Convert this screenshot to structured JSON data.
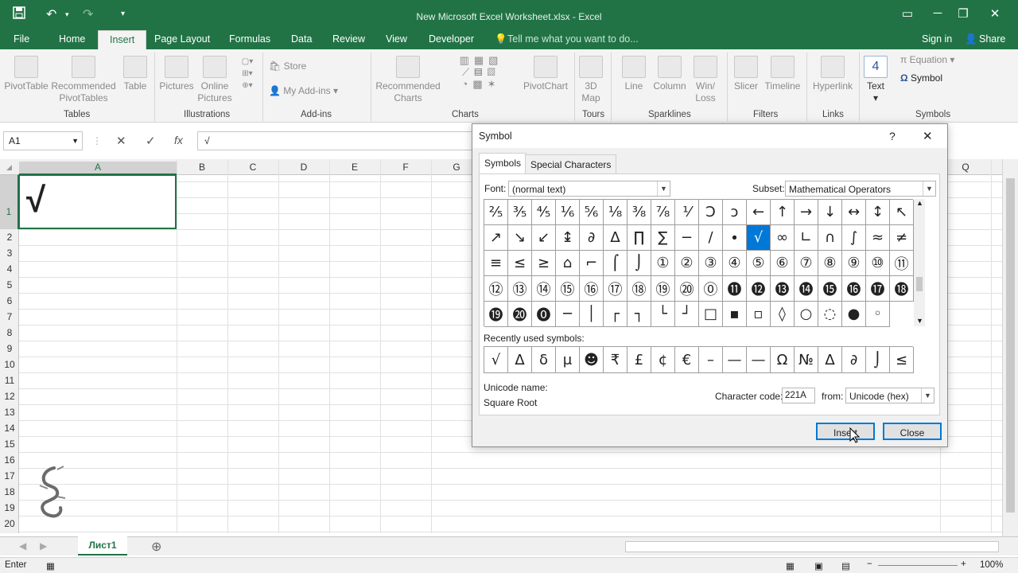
{
  "titlebar": {
    "title": "New Microsoft Excel Worksheet.xlsx - Excel"
  },
  "icons": {
    "save": "save-icon",
    "undo": "undo-icon",
    "redo": "redo-icon",
    "customize": "customize-qat-icon"
  },
  "tabs": [
    "File",
    "Home",
    "Insert",
    "Page Layout",
    "Formulas",
    "Data",
    "Review",
    "View",
    "Developer"
  ],
  "active_tab": "Insert",
  "tellme": "Tell me what you want to do...",
  "signin": "Sign in",
  "share": "Share",
  "ribbon": {
    "pivottable": "PivotTable",
    "recommended_pivot": "Recommended PivotTables",
    "table": "Table",
    "pictures": "Pictures",
    "online_pictures": "Online Pictures",
    "store": "Store",
    "my_addins": "My Add-ins",
    "recommended_charts": "Recommended Charts",
    "pivotchart": "PivotChart",
    "map3d": "3D Map",
    "line": "Line",
    "column": "Column",
    "winloss": "Win/ Loss",
    "slicer": "Slicer",
    "timeline": "Timeline",
    "hyperlink": "Hyperlink",
    "text": "Text",
    "equation": "Equation",
    "symbol": "Symbol",
    "groups": [
      "Tables",
      "Illustrations",
      "Add-ins",
      "Charts",
      "Tours",
      "Sparklines",
      "Filters",
      "Links",
      "Symbols"
    ]
  },
  "formula": {
    "namebox": "A1",
    "cancel": "✕",
    "enter": "✓",
    "fx": "fx",
    "value": "√"
  },
  "columns": [
    "A",
    "B",
    "C",
    "D",
    "E",
    "F",
    "G",
    "Q"
  ],
  "rows": [
    "1",
    "2",
    "3",
    "4",
    "5",
    "6",
    "7",
    "8",
    "9",
    "10",
    "11",
    "12",
    "13",
    "14",
    "15",
    "16",
    "17",
    "18",
    "19",
    "20"
  ],
  "cell_a1": "√",
  "sheet": {
    "tab": "Лист1",
    "add": "⊕"
  },
  "status": {
    "mode": "Enter",
    "zoom": "100%"
  },
  "dialog": {
    "title": "Symbol",
    "help": "?",
    "close_x": "✕",
    "tab_symbols": "Symbols",
    "tab_special": "Special Characters",
    "font_label": "Font:",
    "font_value": "(normal text)",
    "subset_label": "Subset:",
    "subset_value": "Mathematical Operators",
    "symbols": [
      "⅖",
      "⅗",
      "⅘",
      "⅙",
      "⅚",
      "⅛",
      "⅜",
      "⅞",
      "⅟",
      "Ↄ",
      "ↄ",
      "←",
      "↑",
      "→",
      "↓",
      "↔",
      "↕",
      "↖",
      "↗",
      "↘",
      "↙",
      "↨",
      "∂",
      "∆",
      "∏",
      "∑",
      "−",
      "∕",
      "∙",
      "√",
      "∞",
      "∟",
      "∩",
      "∫",
      "≈",
      "≠",
      "≡",
      "≤",
      "≥",
      "⌂",
      "⌐",
      "⌠",
      "⌡",
      "①",
      "②",
      "③",
      "④",
      "⑤",
      "⑥",
      "⑦",
      "⑧",
      "⑨",
      "⑩",
      "⑪",
      "⑫",
      "⑬",
      "⑭",
      "⑮",
      "⑯",
      "⑰",
      "⑱",
      "⑲",
      "⑳",
      "⓪",
      "⓫",
      "⓬",
      "⓭",
      "⓮",
      "⓯",
      "⓰",
      "⓱",
      "⓲",
      "⓳",
      "⓴",
      "⓿",
      "─",
      "│",
      "┌",
      "┐",
      "└",
      "┘",
      "□",
      "▪",
      "▫",
      "◊",
      "○",
      "◌",
      "●",
      "◦"
    ],
    "selected": "√",
    "recent_label": "Recently used symbols:",
    "recent": [
      "√",
      "Δ",
      "δ",
      "μ",
      "☻",
      "₹",
      "£",
      "¢",
      "€",
      "–",
      "—",
      "—",
      "Ω",
      "№",
      "∆",
      "∂",
      "⌡",
      "≤"
    ],
    "unicode_name_label": "Unicode name:",
    "unicode_name": "Square Root",
    "char_code_label": "Character code:",
    "char_code": "221A",
    "from_label": "from:",
    "from_value": "Unicode (hex)",
    "insert": "Insert",
    "close": "Close"
  }
}
